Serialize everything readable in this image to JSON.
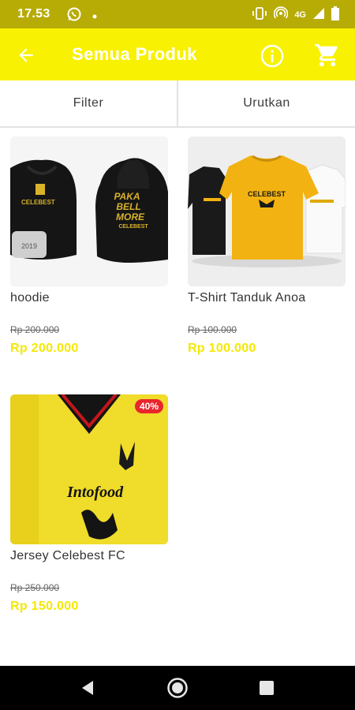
{
  "status_bar": {
    "time": "17.53",
    "network": "4G",
    "icons": [
      "whatsapp-icon",
      "dot-icon",
      "vibrate-icon",
      "hotspot-icon",
      "signal-icon",
      "battery-icon"
    ]
  },
  "app_bar": {
    "title": "Semua Produk",
    "background": "#f8f102",
    "icons": [
      "back-arrow-icon",
      "info-icon",
      "cart-icon"
    ]
  },
  "toolbar": {
    "filter_label": "Filter",
    "sort_label": "Urutkan"
  },
  "products": [
    {
      "name": "hoodie",
      "old_price": "Rp 200.000",
      "price": "Rp 200.000",
      "image_text_front": "CELEBEST",
      "image_text_back_lines": [
        "PAKA",
        "BELL",
        "MORE",
        "CELEBEST"
      ],
      "image_tag": "2019"
    },
    {
      "name": "T-Shirt Tanduk Anoa",
      "old_price": "Rp 100.000",
      "price": "Rp 100.000",
      "image_text": "CELEBEST"
    },
    {
      "name": "Jersey Celebest FC",
      "old_price": "Rp 250.000",
      "price": "Rp 150.000",
      "badge": "40%",
      "image_text": "Intofood"
    }
  ],
  "colors": {
    "accent": "#f8f102",
    "status_bar": "#b7ab06",
    "price": "#f5e800",
    "badge": "#e8262c"
  },
  "nav_bar": {
    "icons": [
      "back-triangle-icon",
      "home-circle-icon",
      "recents-square-icon"
    ]
  }
}
